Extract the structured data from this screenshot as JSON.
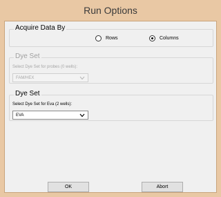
{
  "window": {
    "title": "Run Options"
  },
  "acquire": {
    "legend": "Acquire Data By",
    "options": [
      {
        "label": "Rows",
        "selected": false
      },
      {
        "label": "Columns",
        "selected": true
      }
    ]
  },
  "dye_set_disabled": {
    "legend": "Dye Set",
    "prompt": "Select Dye Set for probes (0 wells):",
    "value": "FAM/HEX"
  },
  "dye_set": {
    "legend": "Dye Set",
    "prompt": "Select Dye Set for Eva (2 wells):",
    "value": "EVA"
  },
  "buttons": {
    "ok": "OK",
    "abort": "Abort"
  }
}
